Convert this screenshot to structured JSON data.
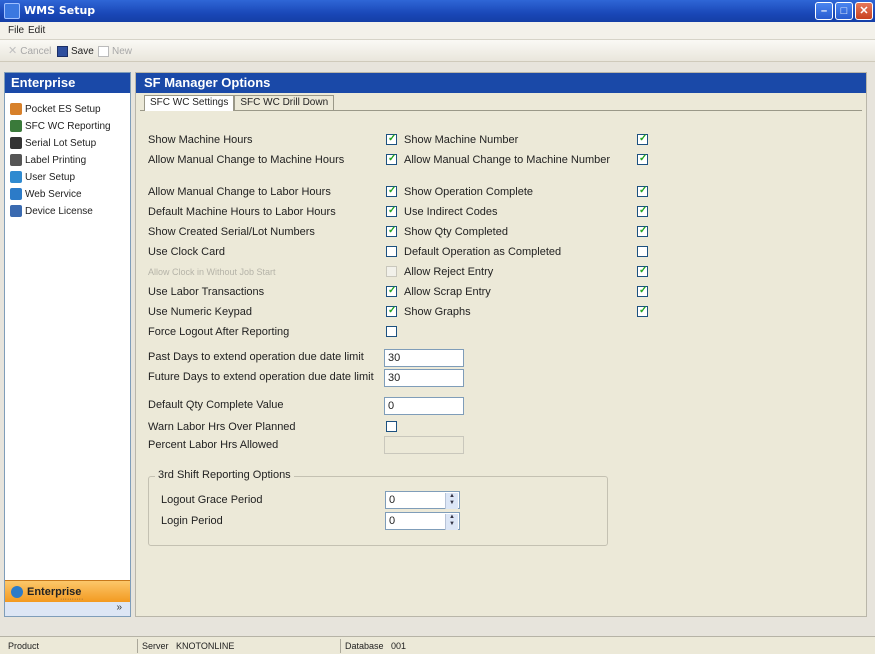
{
  "window": {
    "title": "WMS Setup",
    "min_symbol": "–",
    "max_symbol": "□",
    "close_symbol": "✕"
  },
  "menu": [
    "File",
    "Edit"
  ],
  "toolbar": {
    "cancel": "Cancel",
    "save": "Save",
    "new": "New"
  },
  "sidebar": {
    "header": "Enterprise",
    "items": [
      {
        "label": "Pocket ES Setup",
        "icon": "pocket-icon",
        "color": "#d7802a"
      },
      {
        "label": "SFC WC Reporting",
        "icon": "workcenter-icon",
        "color": "#3a7a3a"
      },
      {
        "label": "Serial Lot Setup",
        "icon": "barcode-icon",
        "color": "#333333"
      },
      {
        "label": "Label Printing",
        "icon": "printer-icon",
        "color": "#555555"
      },
      {
        "label": "User Setup",
        "icon": "user-icon",
        "color": "#2f8ad0"
      },
      {
        "label": "Web Service",
        "icon": "globe-icon",
        "color": "#2c7bc8"
      },
      {
        "label": "Device License",
        "icon": "license-icon",
        "color": "#3a6ab0"
      }
    ],
    "bottom_button": "Enterprise",
    "grip_dots": "··········",
    "grip_chevron": "»"
  },
  "main": {
    "header": "SF Manager Options",
    "tabs": [
      "SFC WC Settings",
      "SFC WC Drill Down"
    ]
  },
  "options_left": [
    {
      "label": "Show Machine Hours",
      "checked": true,
      "disabled": false
    },
    {
      "label": "Allow Manual Change to Machine Hours",
      "checked": true,
      "disabled": false
    },
    {
      "label": "Allow Manual Change to Labor Hours",
      "checked": true,
      "disabled": false
    },
    {
      "label": "Default Machine Hours to Labor Hours",
      "checked": true,
      "disabled": false
    },
    {
      "label": "Show Created Serial/Lot Numbers",
      "checked": true,
      "disabled": false
    },
    {
      "label": "Use Clock Card",
      "checked": false,
      "disabled": false
    },
    {
      "label": "Allow Clock in Without Job Start",
      "checked": false,
      "disabled": true
    },
    {
      "label": "Use Labor Transactions",
      "checked": true,
      "disabled": false
    },
    {
      "label": "Use Numeric Keypad",
      "checked": true,
      "disabled": false
    },
    {
      "label": "Force Logout After Reporting",
      "checked": false,
      "disabled": false
    }
  ],
  "options_right": [
    {
      "label": "Show Machine Number",
      "checked": true
    },
    {
      "label": "Allow Manual Change to Machine Number",
      "checked": true
    },
    {
      "label": "Show Operation Complete",
      "checked": true
    },
    {
      "label": "Use Indirect Codes",
      "checked": true
    },
    {
      "label": "Show Qty Completed",
      "checked": true
    },
    {
      "label": "Default Operation as Completed",
      "checked": false
    },
    {
      "label": "Allow Reject Entry",
      "checked": true
    },
    {
      "label": "Allow Scrap Entry",
      "checked": true
    },
    {
      "label": "Show Graphs",
      "checked": true
    }
  ],
  "fields": {
    "past_days_label": "Past Days to extend operation due date limit",
    "past_days_value": "30",
    "future_days_label": "Future Days to extend operation due date limit",
    "future_days_value": "30",
    "default_qty_label": "Default Qty Complete Value",
    "default_qty_value": "0",
    "warn_labor_label": "Warn Labor Hrs Over Planned",
    "warn_labor_checked": false,
    "percent_labor_label": "Percent Labor Hrs Allowed",
    "percent_labor_value": ""
  },
  "shift_group": {
    "title": "3rd Shift Reporting Options",
    "logout_label": "Logout Grace Period",
    "logout_value": "0",
    "login_label": "Login Period",
    "login_value": "0"
  },
  "statusbar": {
    "product": "Product",
    "server_label": "Server",
    "server_value": "KNOTONLINE",
    "database_label": "Database",
    "database_value": "001"
  }
}
